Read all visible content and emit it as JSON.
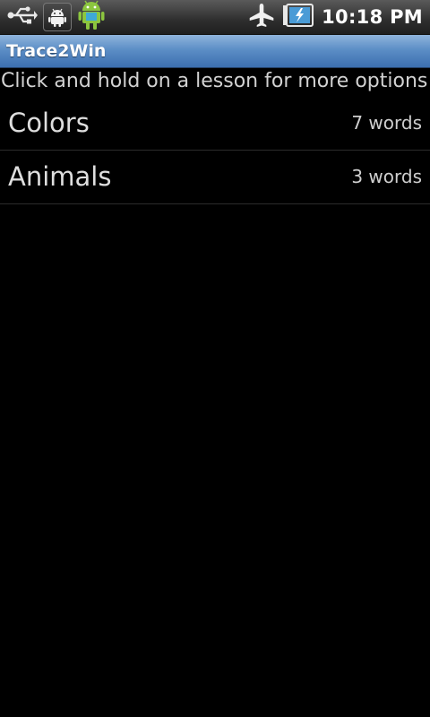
{
  "status_bar": {
    "left_icons": [
      "usb-icon",
      "android-debug-icon",
      "android-mascot-icon"
    ],
    "right_icons": [
      "airplane-mode-icon",
      "battery-charging-icon"
    ],
    "time": "10:18 PM"
  },
  "app": {
    "title": "Trace2Win",
    "hint": "Click and hold on a lesson for more options"
  },
  "lessons": [
    {
      "name": "Colors",
      "count": "7 words"
    },
    {
      "name": "Animals",
      "count": "3 words"
    }
  ],
  "colors": {
    "title_bar": "#4f84c0",
    "background": "#000000"
  }
}
